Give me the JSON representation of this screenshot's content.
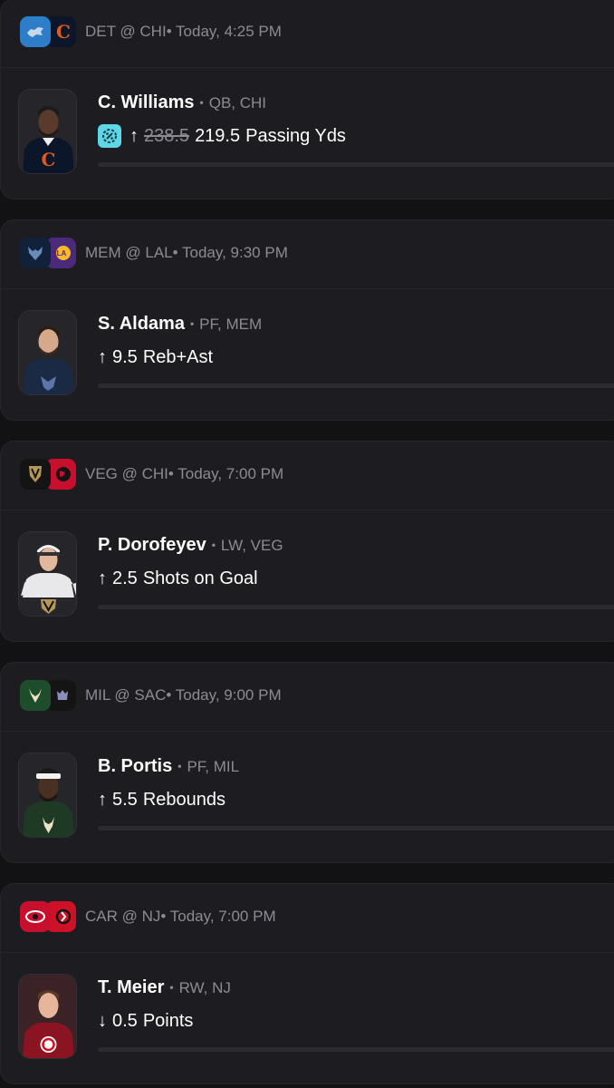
{
  "cards": [
    {
      "game": "DET @ CHI",
      "time": "• Today, 4:25 PM",
      "player_name": "C. Williams",
      "position": "QB, CHI",
      "direction_icon": "arrow-up-icon",
      "direction": "↑",
      "old_line": "238.5",
      "line": "219.5",
      "stat": "Passing Yds",
      "boost_icon": "boost-icon",
      "colors": {
        "away": "#2d7dc8",
        "home": "#0b162a",
        "jersey": "#0b162a"
      }
    },
    {
      "game": "MEM @ LAL",
      "time": "• Today, 9:30 PM",
      "player_name": "S. Aldama",
      "position": "PF, MEM",
      "direction": "↑",
      "line": "9.5",
      "stat": "Reb+Ast",
      "colors": {
        "away": "#12213a",
        "home": "#4b2a7b",
        "jersey": "#1b2a44"
      }
    },
    {
      "game": "VEG @ CHI",
      "time": "• Today, 7:00 PM",
      "player_name": "P. Dorofeyev",
      "position": "LW, VEG",
      "direction": "↑",
      "line": "2.5",
      "stat": "Shots on Goal",
      "colors": {
        "away": "#141414",
        "home": "#c8102e",
        "jersey": "#e8e8ea"
      }
    },
    {
      "game": "MIL @ SAC",
      "time": "• Today, 9:00 PM",
      "player_name": "B. Portis",
      "position": "PF, MIL",
      "direction": "↑",
      "line": "5.5",
      "stat": "Rebounds",
      "colors": {
        "away": "#1e4d2b",
        "home": "#141414",
        "jersey": "#1e3a24"
      }
    },
    {
      "game": "CAR @ NJ",
      "time": "• Today, 7:00 PM",
      "player_name": "T. Meier",
      "position": "RW, NJ",
      "direction": "↓",
      "line": "0.5",
      "stat": "Points",
      "colors": {
        "away": "#c8102e",
        "home": "#ce1126",
        "jersey": "#8a1422"
      }
    }
  ]
}
